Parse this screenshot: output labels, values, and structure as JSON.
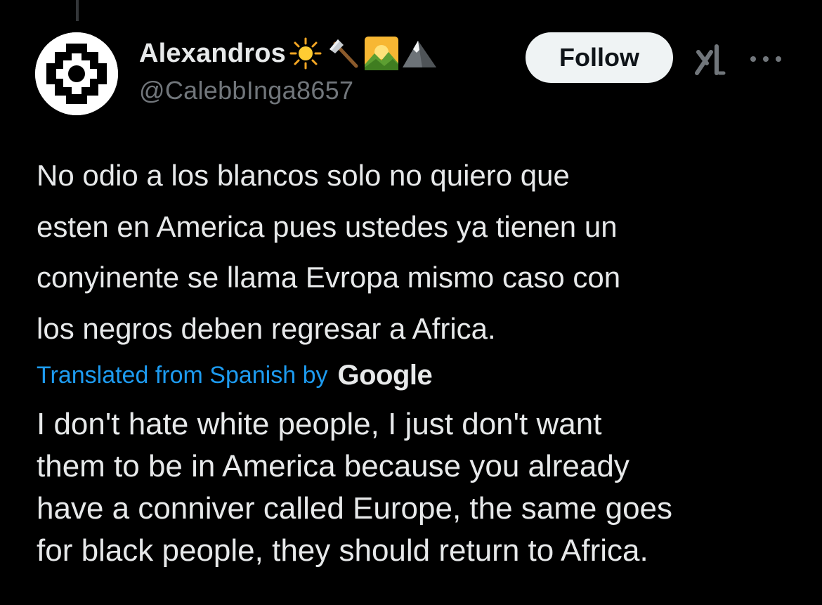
{
  "author": {
    "display_name": "Alexandros",
    "handle": "@CalebbInga8657",
    "emojis": [
      "sun-emoji",
      "axe-emoji",
      "sunrise-over-mountains-emoji",
      "mountain-emoji"
    ]
  },
  "actions": {
    "follow_label": "Follow",
    "grok_icon": "grok-icon",
    "more_icon": "more-dots-icon"
  },
  "tweet": {
    "lines": [
      "No odio a los blancos solo no quiero que",
      "esten en America pues ustedes ya tienen un",
      "conyinente se llama Evropa mismo caso con",
      "los negros deben regresar a Africa."
    ]
  },
  "translation": {
    "label": "Translated from Spanish by",
    "provider": "Google",
    "lines": [
      "I don't hate white people, I just don't want",
      "them to be in America because you already",
      "have a conniver called Europe, the same goes",
      "for black people, they should return to Africa."
    ]
  },
  "colors": {
    "background": "#000000",
    "text": "#e7e9ea",
    "secondary": "#71767b",
    "link": "#1d9bf0",
    "button_bg": "#eff3f4"
  }
}
